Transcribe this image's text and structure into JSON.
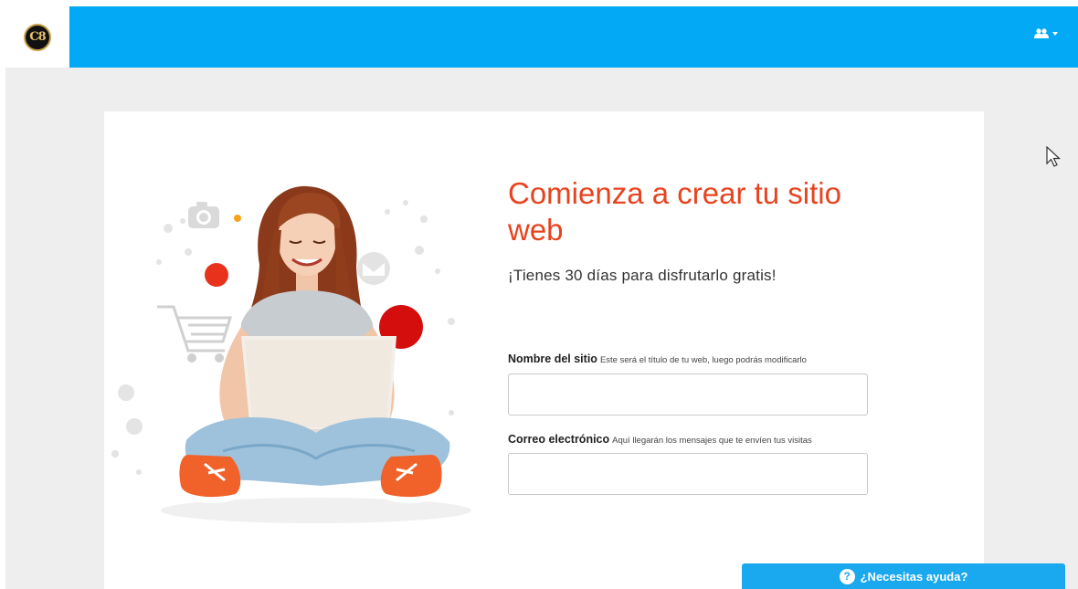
{
  "header": {
    "logo_text": "C8",
    "user_menu_icon": "users-icon",
    "bar_color": "#03a9f4"
  },
  "hero": {
    "title": "Comienza a crear tu sitio web",
    "subtitle": "¡Tienes 30 días para disfrutarlo gratis!",
    "title_color": "#e8431f"
  },
  "form": {
    "site_name": {
      "label": "Nombre del sitio",
      "hint": "Este será el título de tu web, luego podrás modificarlo",
      "value": ""
    },
    "email": {
      "label": "Correo electrónico",
      "hint": "Aquí llegarán los mensajes que te envíen tus visitas",
      "value": ""
    }
  },
  "help": {
    "label": "¿Necesitas ayuda?",
    "icon": "question-circle-icon",
    "color": "#1aa8ee"
  }
}
